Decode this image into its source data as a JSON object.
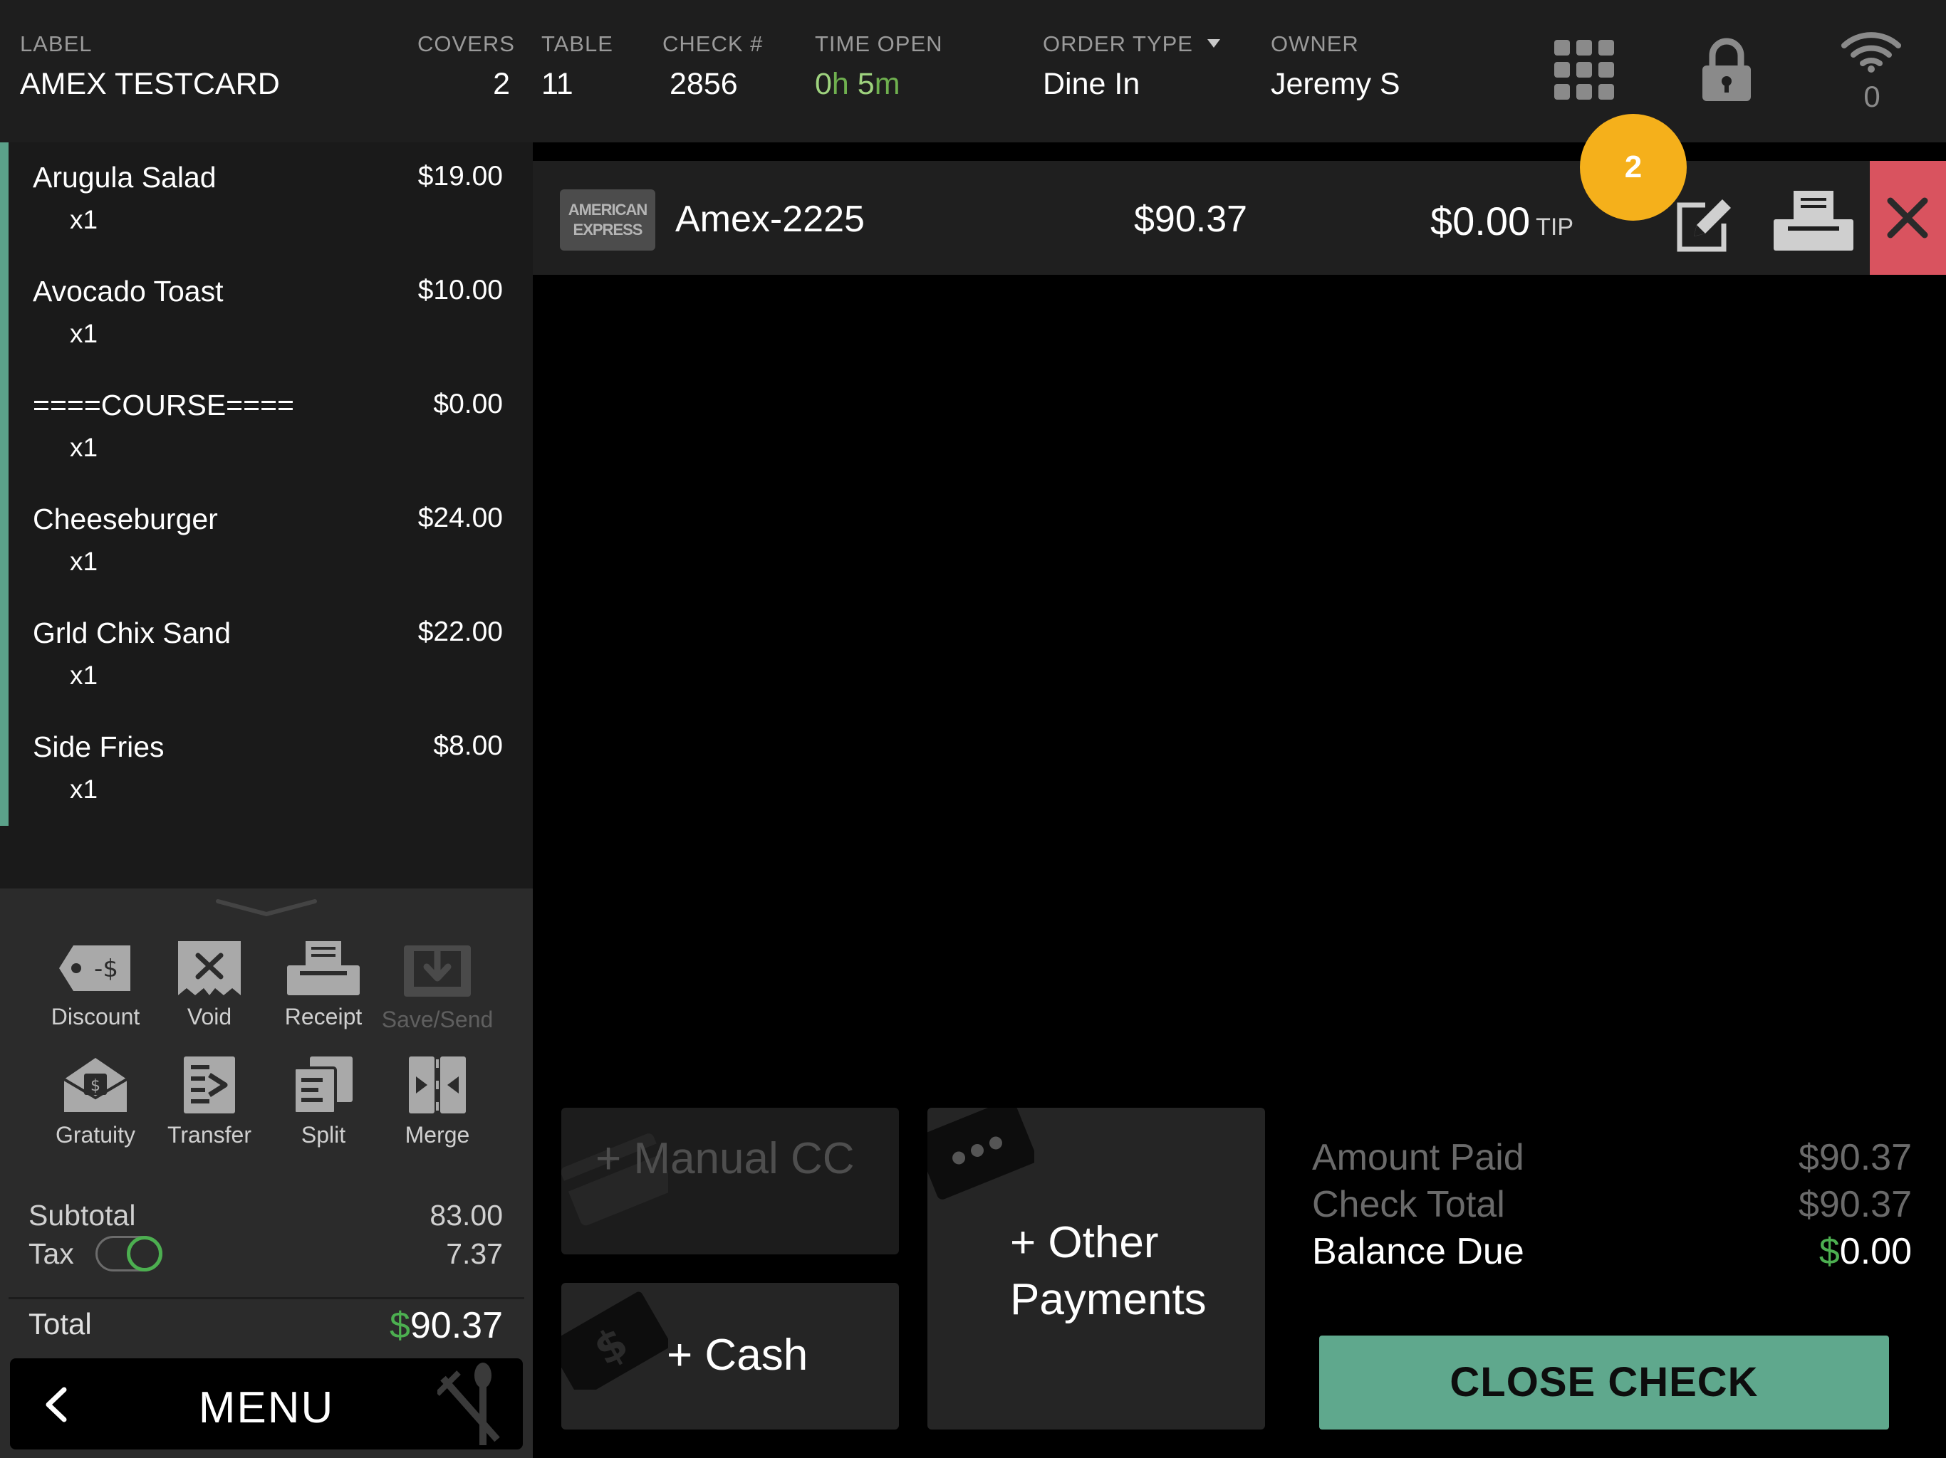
{
  "header": {
    "label_caption": "LABEL",
    "label_value": "AMEX TESTCARD",
    "covers_caption": "COVERS",
    "covers_value": "2",
    "table_caption": "TABLE",
    "table_value": "11",
    "check_caption": "CHECK #",
    "check_value": "2856",
    "time_open_caption": "TIME OPEN",
    "time_open_hours": "0",
    "time_open_hours_unit": "h",
    "time_open_minutes": "5",
    "time_open_minutes_unit": "m",
    "order_type_caption": "ORDER TYPE",
    "order_type_value": "Dine In",
    "owner_caption": "OWNER",
    "owner_value": "Jeremy S",
    "wifi_count": "0"
  },
  "order": {
    "items": [
      {
        "name": "Arugula Salad",
        "price": "$19.00",
        "qty": "x1"
      },
      {
        "name": "Avocado Toast",
        "price": "$10.00",
        "qty": "x1"
      },
      {
        "name": "====COURSE====",
        "price": "$0.00",
        "qty": "x1"
      },
      {
        "name": "Cheeseburger",
        "price": "$24.00",
        "qty": "x1"
      },
      {
        "name": "Grld Chix Sand",
        "price": "$22.00",
        "qty": "x1"
      },
      {
        "name": "Side Fries",
        "price": "$8.00",
        "qty": "x1"
      }
    ]
  },
  "actions": {
    "discount": "Discount",
    "discount_icon_text": "-$",
    "void": "Void",
    "receipt": "Receipt",
    "save_send": "Save/Send",
    "gratuity": "Gratuity",
    "transfer": "Transfer",
    "split": "Split",
    "merge": "Merge"
  },
  "summary": {
    "subtotal_label": "Subtotal",
    "subtotal_value": "83.00",
    "tax_label": "Tax",
    "tax_value": "7.37",
    "tax_enabled": true,
    "total_label": "Total",
    "total_currency": "$",
    "total_value": "90.37"
  },
  "menu": {
    "label": "MENU"
  },
  "payment": {
    "card_logo_line1": "AMERICAN",
    "card_logo_line2": "EXPRESS",
    "card_name": "Amex-2225",
    "amount": "$90.37",
    "tip_amount": "$0.00",
    "tip_label": "TIP",
    "badge_count": "2"
  },
  "pay_buttons": {
    "manual_cc": "+ Manual CC",
    "cash": "+ Cash",
    "other_line1": "+ Other",
    "other_line2": "Payments"
  },
  "totals": {
    "amount_paid_label": "Amount Paid",
    "amount_paid_value": "$90.37",
    "check_total_label": "Check Total",
    "check_total_value": "$90.37",
    "balance_due_label": "Balance Due",
    "balance_due_currency": "$",
    "balance_due_value": "0.00"
  },
  "close_check": {
    "label": "CLOSE CHECK"
  },
  "colors": {
    "accent_green": "#5fa88d",
    "remove_red": "#d9535f",
    "badge_orange": "#f5b01b",
    "money_green": "#4caf50"
  }
}
